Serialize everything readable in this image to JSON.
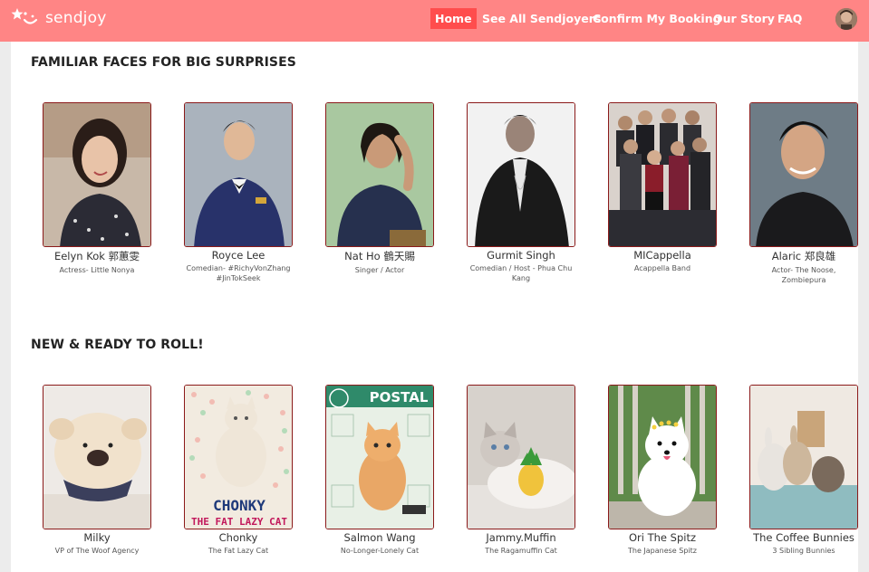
{
  "brand": {
    "name": "sendjoy"
  },
  "nav": {
    "items": [
      {
        "label": "Home",
        "active": true
      },
      {
        "label": "See All Sendjoyers",
        "active": false
      },
      {
        "label": "Confirm My Booking",
        "active": false
      },
      {
        "label": "Our Story",
        "active": false
      },
      {
        "label": "FAQ",
        "active": false
      }
    ]
  },
  "sections": [
    {
      "title": "FAMILIAR FACES FOR BIG SURPRISES",
      "cards": [
        {
          "name": "Eelyn Kok 郭蕙雯",
          "desc": "Actress- Little Nonya"
        },
        {
          "name": "Royce Lee",
          "desc": "Comedian- #RichyVonZhang #JinTokSeek"
        },
        {
          "name": "Nat Ho 鶴天賜",
          "desc": "Singer / Actor"
        },
        {
          "name": "Gurmit Singh",
          "desc": "Comedian / Host - Phua Chu Kang"
        },
        {
          "name": "MICappella",
          "desc": "Acappella Band"
        },
        {
          "name": "Alaric 郑良雄",
          "desc": "Actor- The Noose, Zombiepura"
        }
      ]
    },
    {
      "title": "NEW & READY TO ROLL!",
      "cards": [
        {
          "name": "Milky",
          "desc": "VP of The Woof Agency"
        },
        {
          "name": "Chonky",
          "desc": "The Fat Lazy Cat",
          "photo_text": "CHONKY",
          "photo_subtext": "THE FAT LAZY CAT"
        },
        {
          "name": "Salmon Wang",
          "desc": "No-Longer-Lonely Cat",
          "photo_text": "POSTAL"
        },
        {
          "name": "Jammy.Muffin",
          "desc": "The Ragamuffin Cat"
        },
        {
          "name": "Ori The Spitz",
          "desc": "The Japanese Spitz"
        },
        {
          "name": "The Coffee Bunnies",
          "desc": "3 Sibling Bunnies"
        }
      ]
    }
  ],
  "colors": {
    "navbar": "#ff8585",
    "nav_active": "#ff4d4d",
    "card_border": "#8b1a1a"
  }
}
